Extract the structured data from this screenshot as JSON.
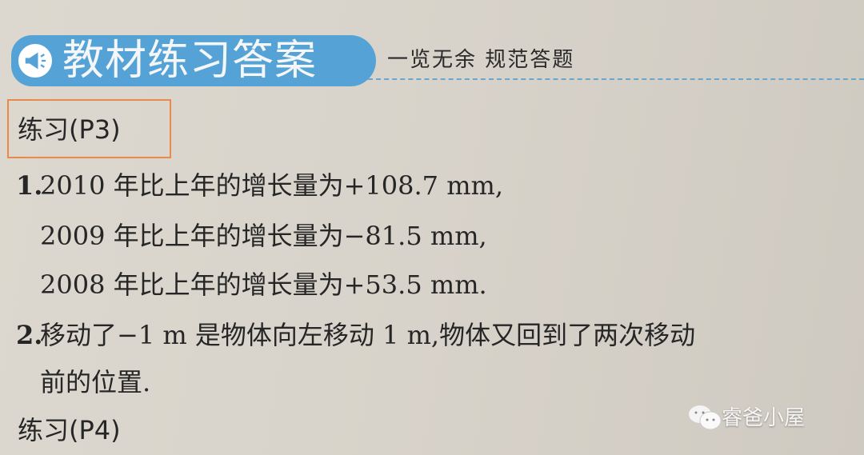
{
  "header": {
    "title": "教材练习答案",
    "subtitle": "一览无余  规范答题",
    "icon": "megaphone-icon",
    "accent_color": "#55a3d6",
    "highlight_color": "#e98a4a"
  },
  "sections": [
    {
      "heading": "练习(P3)",
      "items": [
        {
          "number": "1.",
          "lines": [
            "2010 年比上年的增长量为+108.7 mm,",
            "2009 年比上年的增长量为−81.5 mm,",
            "2008 年比上年的增长量为+53.5 mm."
          ]
        },
        {
          "number": "2.",
          "lines": [
            "移动了−1 m 是物体向左移动 1 m,物体又回到了两次移动",
            "前的位置."
          ]
        }
      ]
    },
    {
      "heading": "练习(P4)"
    }
  ],
  "watermark": {
    "icon": "wechat-icon",
    "text": "睿爸小屋"
  }
}
